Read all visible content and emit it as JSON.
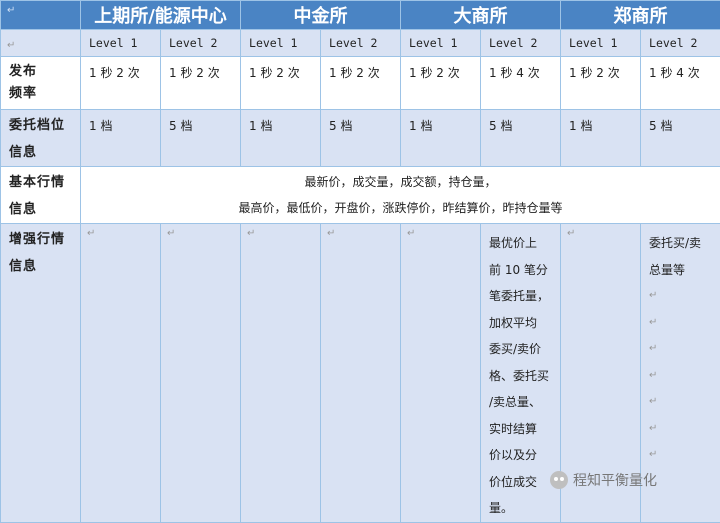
{
  "header": {
    "corner_mark": "↵",
    "exchanges": [
      "上期所/能源中心",
      "中金所",
      "大商所",
      "郑商所"
    ]
  },
  "levels": {
    "row_mark": "↵",
    "labels": [
      "Level 1",
      "Level 2",
      "Level 1",
      "Level 2",
      "Level 1",
      "Level 2",
      "Level 1",
      "Level 2"
    ]
  },
  "freq": {
    "label_line1": "发布",
    "label_line2": "频率",
    "values": [
      "1 秒 2 次",
      "1 秒 2 次",
      "1 秒 2 次",
      "1 秒 2 次",
      "1 秒 2 次",
      "1 秒 4 次",
      "1 秒 2 次",
      "1 秒 4 次"
    ]
  },
  "order_levels": {
    "label_line1": "委托档位",
    "label_line2": "信息",
    "values": [
      "1 档",
      "5 档",
      "1 档",
      "5 档",
      "1 档",
      "5 档",
      "1 档",
      "5 档"
    ]
  },
  "basic": {
    "label_line1": "基本行情",
    "label_line2": "信息",
    "line1": "最新价，成交量，成交额，持仓量，",
    "line2": "最高价，最低价，开盘价，涨跌停价，昨结算价，昨持仓量等"
  },
  "enhanced": {
    "label_line1": "增强行情",
    "label_line2": "信息",
    "dce_l2": [
      "最优价上",
      "前 10 笔分",
      "笔委托量，",
      "加权平均",
      "委买/卖价",
      "格、委托买",
      "/卖总量、",
      "实时结算",
      "价以及分",
      "价位成交",
      "量。"
    ],
    "czce_l2": [
      "委托买/卖",
      "总量等"
    ],
    "empty_mark": "↵"
  },
  "watermark": {
    "text": "程知平衡量化",
    "icon": "wechat-icon"
  }
}
